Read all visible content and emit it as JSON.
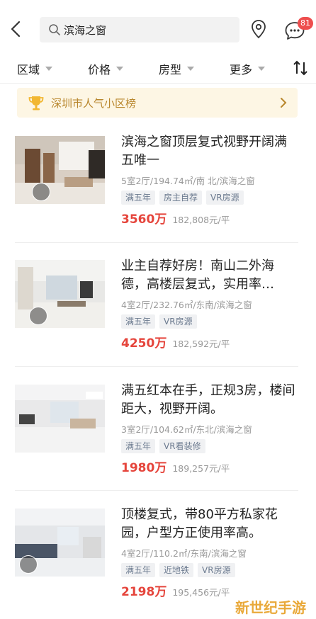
{
  "search": {
    "value": "滨海之窗",
    "placeholder": ""
  },
  "notifications": {
    "count": "81"
  },
  "filters": [
    {
      "label": "区域",
      "icon": "caret-down-icon"
    },
    {
      "label": "价格",
      "icon": "caret-down-icon"
    },
    {
      "label": "房型",
      "icon": "caret-down-icon"
    },
    {
      "label": "更多",
      "icon": "caret-down-icon"
    }
  ],
  "banner": {
    "text": "深圳市人气小区榜",
    "icon": "trophy-icon"
  },
  "listings": [
    {
      "title": "滨海之窗顶层复式视野开阔满五唯一",
      "meta": "5室2厅/194.74㎡/南 北/滨海之窗",
      "tags": [
        "满五年",
        "房主自荐",
        "VR房源"
      ],
      "price": "3560万",
      "unit_price": "182,808元/平"
    },
    {
      "title": "业主自荐好房！南山二外海德，高楼层复式，实用率…",
      "meta": "4室2厅/232.76㎡/东南/滨海之窗",
      "tags": [
        "满五年",
        "VR房源"
      ],
      "price": "4250万",
      "unit_price": "182,592元/平"
    },
    {
      "title": "满五红本在手，正规3房，楼间距大，视野开阔。",
      "meta": "3室2厅/104.62㎡/东北/滨海之窗",
      "tags": [
        "满五年",
        "VR看装修"
      ],
      "price": "1980万",
      "unit_price": "189,257元/平"
    },
    {
      "title": "顶楼复式，带80平方私家花园，户型方正使用率高。",
      "meta": "4室2厅/110.2㎡/东南/滨海之窗",
      "tags": [
        "满五年",
        "近地铁",
        "VR房源"
      ],
      "price": "2198万",
      "unit_price": "195,456元/平"
    }
  ],
  "watermark": "新世纪手游",
  "colors": {
    "price": "#e5453c",
    "banner_bg": "#fdf6e4",
    "banner_text": "#b8862c",
    "badge": "#ee4e4e",
    "tag_text": "#6b7a8f"
  }
}
